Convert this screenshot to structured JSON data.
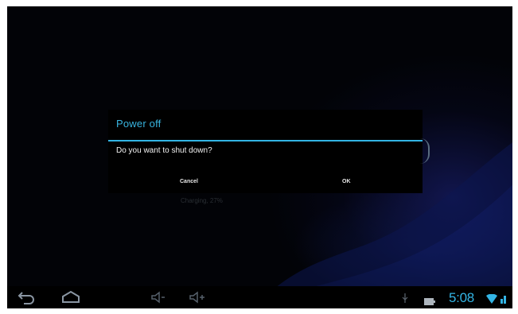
{
  "dialog": {
    "title": "Power off",
    "message": "Do you want to shut down?",
    "cancel_label": "Cancel",
    "ok_label": "OK"
  },
  "lockscreen": {
    "charging_text": "Charging, 27%"
  },
  "status_bar": {
    "time": "5:08"
  },
  "icons": {
    "nav": [
      "back-icon",
      "home-icon",
      "volume-down-icon",
      "volume-up-icon"
    ],
    "status": [
      "usb-icon",
      "battery-icon",
      "wifi-icon",
      "signal-icon"
    ]
  },
  "colors": {
    "accent": "#33b5e5",
    "background": "#020307",
    "dialog_background": "#000000"
  }
}
